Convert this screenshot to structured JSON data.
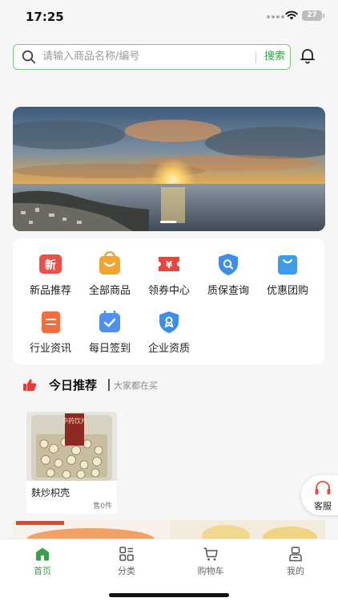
{
  "status_bar": {
    "time": "17:25",
    "battery": "27"
  },
  "search": {
    "placeholder": "请输入商品名称/编号",
    "button_label": "搜索"
  },
  "menu": {
    "items": [
      {
        "label": "新品推荐",
        "icon": "new-badge-icon",
        "color": "#e8504a"
      },
      {
        "label": "全部商品",
        "icon": "shopping-bag-icon",
        "color": "#f0a531"
      },
      {
        "label": "领券中心",
        "icon": "coupon-icon",
        "color": "#e9463f"
      },
      {
        "label": "质保查询",
        "icon": "shield-search-icon",
        "color": "#3b8fe8"
      },
      {
        "label": "优惠团购",
        "icon": "bag-icon",
        "color": "#3d9be9"
      },
      {
        "label": "行业资讯",
        "icon": "document-icon",
        "color": "#ef6d3f"
      },
      {
        "label": "每日签到",
        "icon": "calendar-check-icon",
        "color": "#4f8ff0"
      },
      {
        "label": "企业资质",
        "icon": "certificate-shield-icon",
        "color": "#3b8fe8"
      }
    ]
  },
  "recommend": {
    "title": "今日推荐",
    "subtitle": "大家都在买",
    "products": [
      {
        "name": "麸炒枳壳",
        "sold": "售0件",
        "package_text": "中药饮片"
      }
    ]
  },
  "service": {
    "label": "客服"
  },
  "tab_bar": {
    "tabs": [
      {
        "label": "首页",
        "icon": "home-icon",
        "active": true
      },
      {
        "label": "分类",
        "icon": "category-grid-icon",
        "active": false
      },
      {
        "label": "购物车",
        "icon": "cart-icon",
        "active": false
      },
      {
        "label": "我的",
        "icon": "profile-icon",
        "active": false
      }
    ]
  },
  "colors": {
    "accent": "#3aa14a",
    "search_border": "#7cc67f",
    "background": "#f6f6f6"
  }
}
